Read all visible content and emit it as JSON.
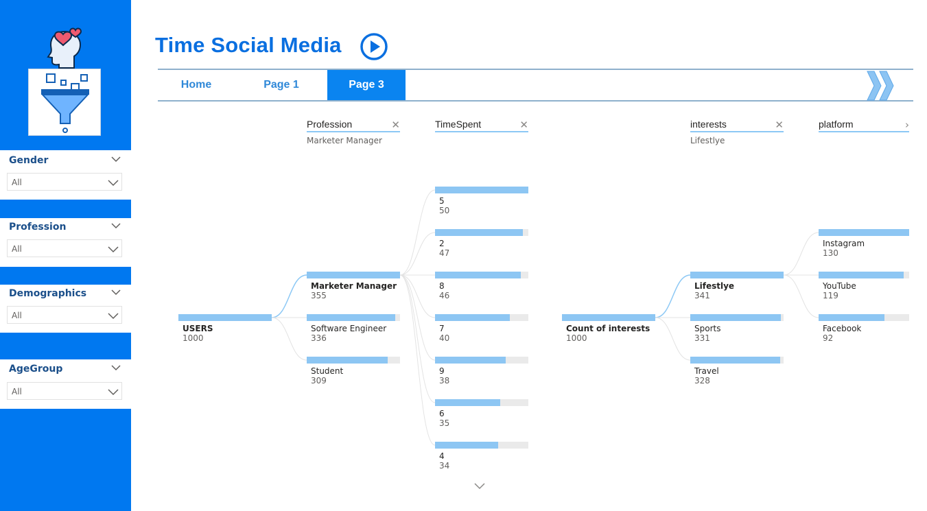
{
  "header": {
    "title": "Time Social Media"
  },
  "nav": {
    "tabs": [
      {
        "label": "Home"
      },
      {
        "label": "Page 1"
      },
      {
        "label": "Page 3"
      }
    ],
    "active": 2
  },
  "slicers": [
    {
      "title": "Gender",
      "value": "All"
    },
    {
      "title": "Profession",
      "value": "All"
    },
    {
      "title": "Demographics",
      "value": "All"
    },
    {
      "title": "AgeGroup",
      "value": "All"
    }
  ],
  "tree1": {
    "root": {
      "label": "USERS",
      "value": "1000"
    },
    "levels": [
      {
        "title": "Profession",
        "filter": "Marketer Manager"
      },
      {
        "title": "TimeSpent",
        "filter": ""
      }
    ],
    "profession": [
      {
        "label": "Marketer Manager",
        "value": 355
      },
      {
        "label": "Software Engineer",
        "value": 336
      },
      {
        "label": "Student",
        "value": 309
      }
    ],
    "timespent": [
      {
        "label": "5",
        "value": 50
      },
      {
        "label": "2",
        "value": 47
      },
      {
        "label": "8",
        "value": 46
      },
      {
        "label": "7",
        "value": 40
      },
      {
        "label": "9",
        "value": 38
      },
      {
        "label": "6",
        "value": 35
      },
      {
        "label": "4",
        "value": 34
      }
    ]
  },
  "tree2": {
    "root": {
      "label": "Count of interests",
      "value": "1000"
    },
    "levels": [
      {
        "title": "interests",
        "filter": "Lifestlye"
      },
      {
        "title": "platform",
        "filter": ""
      }
    ],
    "interests": [
      {
        "label": "Lifestlye",
        "value": 341
      },
      {
        "label": "Sports",
        "value": 331
      },
      {
        "label": "Travel",
        "value": 328
      }
    ],
    "platform": [
      {
        "label": "Instagram",
        "value": 130
      },
      {
        "label": "YouTube",
        "value": 119
      },
      {
        "label": "Facebook",
        "value": 92
      }
    ]
  },
  "colors": {
    "accent": "#0078f0",
    "bar": "#8dc6f3",
    "track": "#eaeaea",
    "title": "#0a6fe0"
  },
  "icons": [
    "head-heart-icon",
    "funnel-filter-icon",
    "play-circle-icon",
    "chevron-down-icon",
    "close-icon",
    "chevron-right-icon",
    "double-chevron-icon"
  ]
}
